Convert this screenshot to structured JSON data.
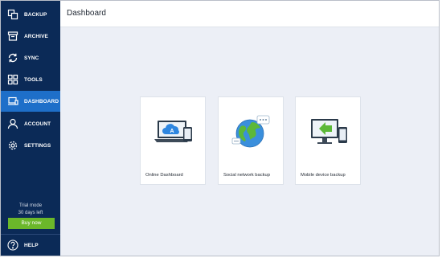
{
  "sidebar": {
    "items": [
      {
        "label": "BACKUP",
        "icon": "backup-icon",
        "active": false
      },
      {
        "label": "ARCHIVE",
        "icon": "archive-icon",
        "active": false
      },
      {
        "label": "SYNC",
        "icon": "sync-icon",
        "active": false
      },
      {
        "label": "TOOLS",
        "icon": "tools-icon",
        "active": false
      },
      {
        "label": "DASHBOARD",
        "icon": "dashboard-icon",
        "active": true
      },
      {
        "label": "ACCOUNT",
        "icon": "account-icon",
        "active": false
      },
      {
        "label": "SETTINGS",
        "icon": "settings-icon",
        "active": false
      }
    ],
    "trial_mode": "Trial mode",
    "days_left": "30 days left",
    "buy_label": "Buy now",
    "help_label": "HELP"
  },
  "header": {
    "title": "Dashboard"
  },
  "cards": [
    {
      "label": "Online Dashboard",
      "illustration": "laptop-cloud-icon"
    },
    {
      "label": "Social network backup",
      "illustration": "globe-chat-icon"
    },
    {
      "label": "Mobile device backup",
      "illustration": "monitor-phone-icon"
    }
  ],
  "colors": {
    "sidebar_bg": "#0b2a57",
    "active_item": "#1e6fc9",
    "buy_button": "#6bb82a",
    "content_bg": "#eceff6"
  }
}
